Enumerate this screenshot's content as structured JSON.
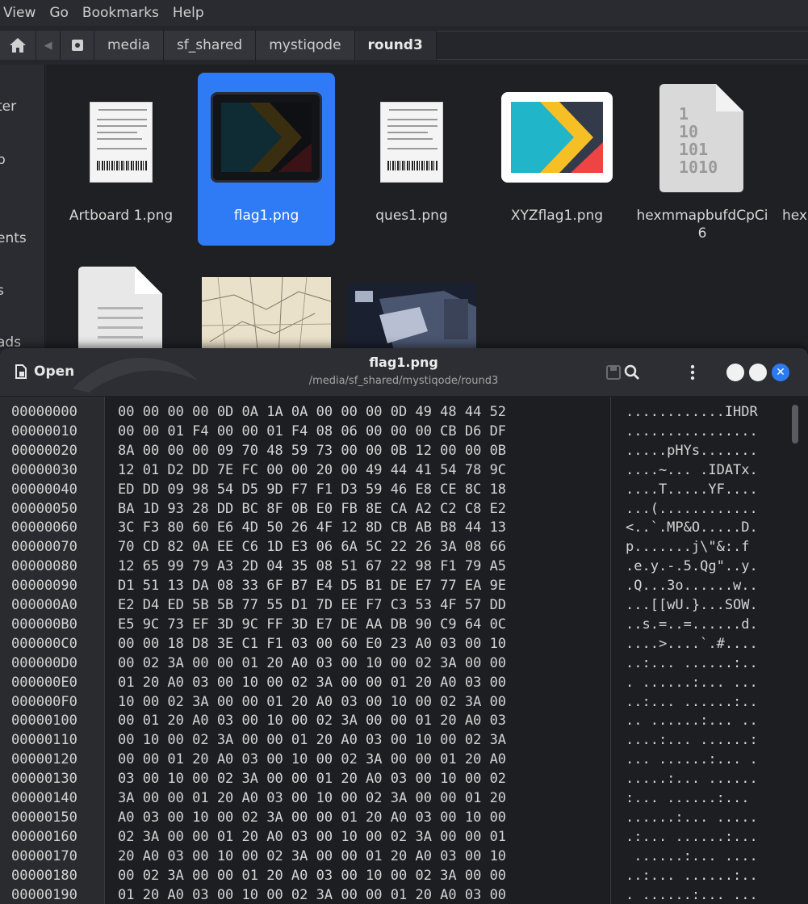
{
  "file_manager": {
    "menu": [
      "View",
      "Go",
      "Bookmarks",
      "Help"
    ],
    "breadcrumbs": [
      "media",
      "sf_shared",
      "mystiqode",
      "round3"
    ],
    "sidebar_items": [
      "ter",
      "p",
      "ents",
      "s",
      "ads"
    ],
    "files": [
      {
        "name": "Artboard 1.png",
        "kind": "receipt",
        "selected": false
      },
      {
        "name": "flag1.png",
        "kind": "flag-dark",
        "selected": true
      },
      {
        "name": "ques1.png",
        "kind": "receipt",
        "selected": false
      },
      {
        "name": "XYZflag1.png",
        "kind": "flag",
        "selected": false
      },
      {
        "name": "hexmmapbufdCpCi\n6",
        "kind": "binary",
        "selected": false
      },
      {
        "name": "hexi",
        "kind": "binary",
        "selected": false
      }
    ],
    "binary_icon_text": [
      "1",
      "10",
      "101",
      "1010"
    ]
  },
  "hex_editor": {
    "open_label": "Open",
    "title": "flag1.png",
    "subtitle": "/media/sf_shared/mystiqode/round3",
    "colors": {
      "accent": "#2b7bf0",
      "selected_tile": "#2f7bf5",
      "flag_blue": "#20b5c8",
      "flag_yellow": "#f6bf26",
      "flag_red": "#ee4444",
      "flag_dark": "#333a4a"
    },
    "offsets": [
      "00000000",
      "00000010",
      "00000020",
      "00000030",
      "00000040",
      "00000050",
      "00000060",
      "00000070",
      "00000080",
      "00000090",
      "000000A0",
      "000000B0",
      "000000C0",
      "000000D0",
      "000000E0",
      "000000F0",
      "00000100",
      "00000110",
      "00000120",
      "00000130",
      "00000140",
      "00000150",
      "00000160",
      "00000170",
      "00000180",
      "00000190"
    ],
    "hex_rows": [
      "00 00 00 00 0D 0A 1A 0A 00 00 00 0D 49 48 44 52",
      "00 00 01 F4 00 00 01 F4 08 06 00 00 00 CB D6 DF",
      "8A 00 00 00 09 70 48 59 73 00 00 0B 12 00 00 0B",
      "12 01 D2 DD 7E FC 00 00 20 00 49 44 41 54 78 9C",
      "ED DD 09 98 54 D5 9D F7 F1 D3 59 46 E8 CE 8C 18",
      "BA 1D 93 28 DD BC 8F 0B E0 FB 8E CA A2 C2 C8 E2",
      "3C F3 80 60 E6 4D 50 26 4F 12 8D CB AB B8 44 13",
      "70 CD 82 0A EE C6 1D E3 06 6A 5C 22 26 3A 08 66",
      "12 65 99 79 A3 2D 04 35 08 51 67 22 98 F1 79 A5",
      "D1 51 13 DA 08 33 6F B7 E4 D5 B1 DE E7 77 EA 9E",
      "E2 D4 ED 5B 5B 77 55 D1 7D EE F7 C3 53 4F 57 DD",
      "E5 9C 73 EF 3D 9C FF 3D E7 DE AA DB 90 C9 64 0C",
      "00 00 18 D8 3E C1 F1 03 00 60 E0 23 A0 03 00 10",
      "00 02 3A 00 00 01 20 A0 03 00 10 00 02 3A 00 00",
      "01 20 A0 03 00 10 00 02 3A 00 00 01 20 A0 03 00",
      "10 00 02 3A 00 00 01 20 A0 03 00 10 00 02 3A 00",
      "00 01 20 A0 03 00 10 00 02 3A 00 00 01 20 A0 03",
      "00 10 00 02 3A 00 00 01 20 A0 03 00 10 00 02 3A",
      "00 00 01 20 A0 03 00 10 00 02 3A 00 00 01 20 A0",
      "03 00 10 00 02 3A 00 00 01 20 A0 03 00 10 00 02",
      "3A 00 00 01 20 A0 03 00 10 00 02 3A 00 00 01 20",
      "A0 03 00 10 00 02 3A 00 00 01 20 A0 03 00 10 00",
      "02 3A 00 00 01 20 A0 03 00 10 00 02 3A 00 00 01",
      "20 A0 03 00 10 00 02 3A 00 00 01 20 A0 03 00 10",
      "00 02 3A 00 00 01 20 A0 03 00 10 00 02 3A 00 00",
      "01 20 A0 03 00 10 00 02 3A 00 00 01 20 A0 03 00"
    ],
    "ascii_rows": [
      "............IHDR",
      "................",
      ".....pHYs.......",
      "....~... .IDATx.",
      "....T.....YF....",
      "...(............",
      "<..`.MP&O.....D.",
      "p.......j\\\"&:.f",
      ".e.y.-.5.Qg\"..y.",
      ".Q...3o......w..",
      "...[[wU.}...SOW.",
      "..s.=..=......d.",
      "....>....`.#....",
      "..:... ......:..",
      ". ......:... ...",
      "..:... ......:..",
      ".. ......:... ..",
      "....:... ......:",
      "... ......:... .",
      ".....:... ......",
      ":... ......:...",
      "......:... .....",
      ".:... ......:...",
      " ......:... ....",
      "..:... ......:..",
      ". ......:... ..."
    ]
  }
}
